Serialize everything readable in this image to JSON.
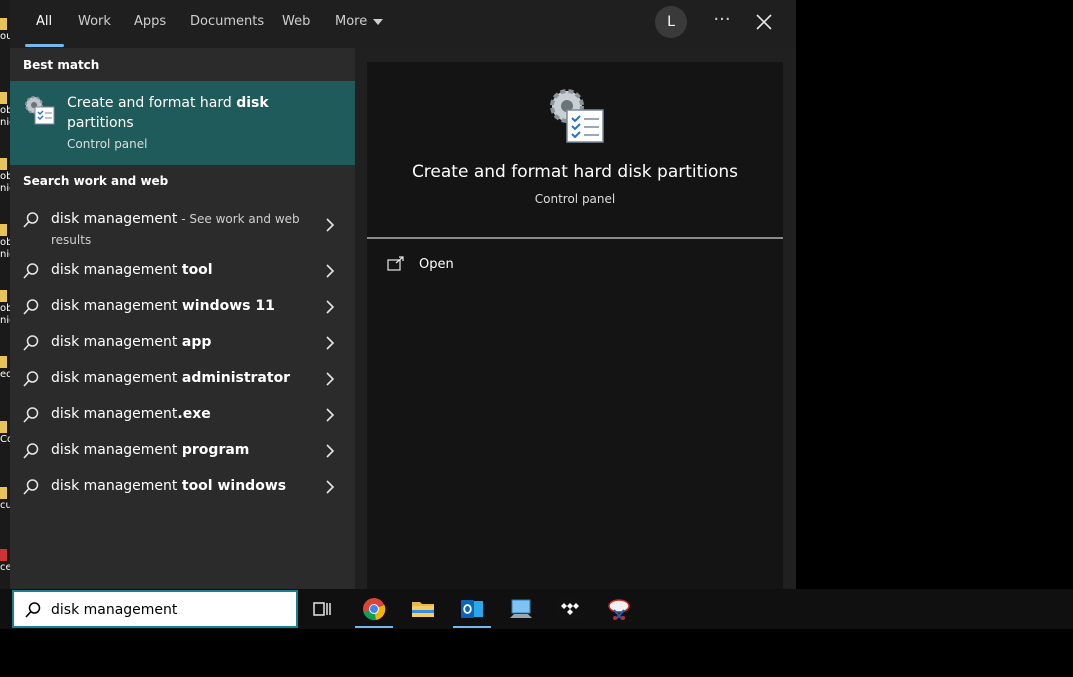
{
  "tabs": [
    {
      "label": "All"
    },
    {
      "label": "Work"
    },
    {
      "label": "Apps"
    },
    {
      "label": "Documents"
    },
    {
      "label": "Web"
    },
    {
      "label": "More"
    }
  ],
  "account_initial": "L",
  "options_glyph": "···",
  "best_match": {
    "heading": "Best match",
    "title_pre": "Create and format hard ",
    "title_bold": "disk",
    "title_post": "partitions",
    "subtitle": "Control panel",
    "icon": "disk-management-icon"
  },
  "web_section": {
    "heading": "Search work and web",
    "items": [
      {
        "prefix": "disk management",
        "bold": "",
        "hint": " - See work and web",
        "line2": "results"
      },
      {
        "prefix": "disk management ",
        "bold": "tool"
      },
      {
        "prefix": "disk management ",
        "bold": "windows 11"
      },
      {
        "prefix": "disk management ",
        "bold": "app"
      },
      {
        "prefix": "disk management ",
        "bold": "administrator"
      },
      {
        "prefix": "disk management",
        "bold": ".exe"
      },
      {
        "prefix": "disk management ",
        "bold": "program"
      },
      {
        "prefix": "disk management ",
        "bold": "tool windows"
      }
    ]
  },
  "preview": {
    "title": "Create and format hard disk partitions",
    "subtitle": "Control panel",
    "actions": [
      {
        "label": "Open",
        "icon": "open-icon"
      }
    ]
  },
  "search": {
    "value": "disk management"
  },
  "desktop_labels": [
    "ou",
    "ob",
    "nic",
    "ob",
    "nic",
    "ob",
    "nic",
    "ob",
    "nic",
    "ed",
    "Co",
    "cul",
    "ce2"
  ],
  "taskbar": {
    "apps": [
      "task-view",
      "chrome",
      "file-explorer",
      "outlook",
      "remote-desktop",
      "tidal",
      "snipping-tool"
    ],
    "accent": "#76b9ed"
  },
  "colors": {
    "highlight": "#1f5b5b",
    "panel": "#2b2b2b",
    "preview_bg": "#141414"
  }
}
